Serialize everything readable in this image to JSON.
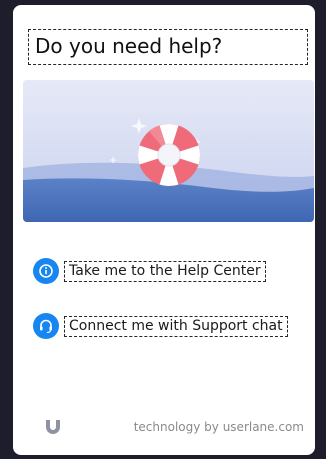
{
  "title": "Do you need help?",
  "options": [
    {
      "label": "Take me to the Help Center",
      "icon": "info-icon"
    },
    {
      "label": "Connect me with Support chat",
      "icon": "headset-icon"
    }
  ],
  "footer": {
    "text": "technology by userlane.com",
    "logo": "userlane-logo-icon"
  },
  "colors": {
    "accent": "#1886f0",
    "backdrop": "#1e1d2b",
    "buoy": "#ef6b7a"
  }
}
